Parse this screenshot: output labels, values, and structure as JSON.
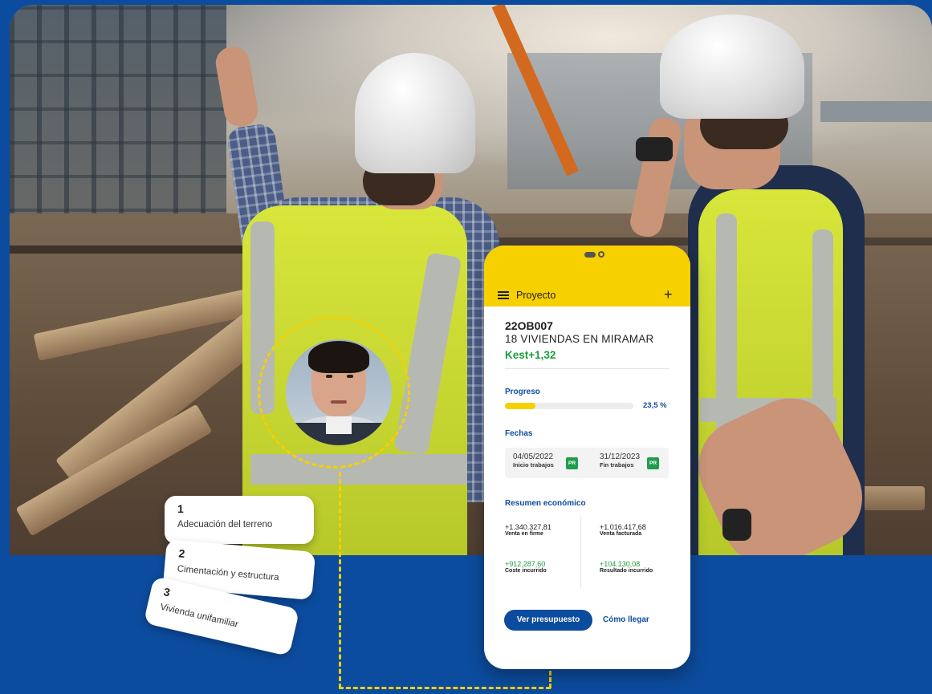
{
  "steps": [
    {
      "number": "1",
      "label": "Adecuación del terreno"
    },
    {
      "number": "2",
      "label": "Cimentación y estructura"
    },
    {
      "number": "3",
      "label": "Vivienda unifamiliar"
    }
  ],
  "phone": {
    "header": {
      "title": "Proyecto",
      "menu_icon": "hamburger-menu-icon",
      "add_icon": "plus-icon"
    },
    "project": {
      "code": "22OB007",
      "name": "18 VIVIENDAS EN MIRAMAR",
      "kest": "Kest+1,32"
    },
    "progress": {
      "label": "Progreso",
      "value_text": "23,5 %",
      "fraction": 0.235
    },
    "dates": {
      "label": "Fechas",
      "start": {
        "date": "04/05/2022",
        "caption": "Inicio trabajos",
        "badge": "PR"
      },
      "end": {
        "date": "31/12/2023",
        "caption": "Fin trabajos",
        "badge": "PR"
      }
    },
    "summary": {
      "label": "Resumen económico",
      "items": [
        {
          "value": "+1.340.327,81",
          "caption": "Venta en firme"
        },
        {
          "value": "+1.016.417,68",
          "caption": "Venta facturada"
        },
        {
          "value": "+912.287,60",
          "caption": "Coste incurrido"
        },
        {
          "value": "+104.130,08",
          "caption": "Resultado incurrido"
        }
      ]
    },
    "actions": {
      "primary": "Ver presupuesto",
      "secondary": "Cómo llegar"
    }
  },
  "colors": {
    "brand_blue": "#0c4c9e",
    "accent_yellow": "#f7d000",
    "positive_green": "#1a9e3a"
  }
}
